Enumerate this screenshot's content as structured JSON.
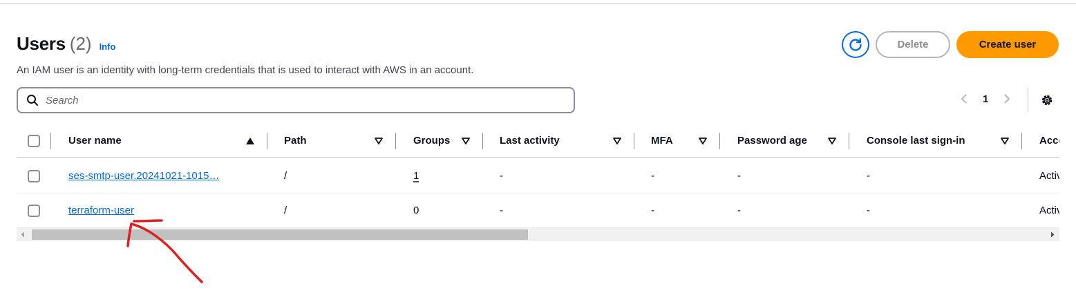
{
  "header": {
    "title": "Users",
    "count": "(2)",
    "info": "Info",
    "description": "An IAM user is an identity with long-term credentials that is used to interact with AWS in an account."
  },
  "actions": {
    "refresh_icon": "refresh-icon",
    "delete_label": "Delete",
    "create_label": "Create user"
  },
  "search": {
    "placeholder": "Search"
  },
  "pagination": {
    "current_page": "1"
  },
  "table": {
    "columns": [
      {
        "label": "User name"
      },
      {
        "label": "Path"
      },
      {
        "label": "Groups"
      },
      {
        "label": "Last activity"
      },
      {
        "label": "MFA"
      },
      {
        "label": "Password age"
      },
      {
        "label": "Console last sign-in"
      },
      {
        "label": "Access key ID"
      }
    ],
    "rows": [
      {
        "user_name": "ses-smtp-user.20241021-1015…",
        "path": "/",
        "groups": "1",
        "last_activity": "-",
        "mfa": "-",
        "password_age": "-",
        "console_last_sign_in": "-",
        "access_key": "Active"
      },
      {
        "user_name": "terraform-user",
        "path": "/",
        "groups": "0",
        "last_activity": "-",
        "mfa": "-",
        "password_age": "-",
        "console_last_sign_in": "-",
        "access_key": "Active"
      }
    ]
  },
  "colors": {
    "primary_link": "#006ce0",
    "create_button": "#ff9900",
    "annotation_stroke": "#e02020"
  }
}
